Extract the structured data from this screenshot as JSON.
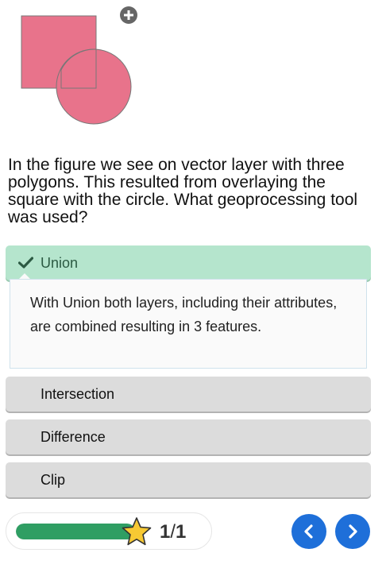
{
  "figure": {
    "square_color": "#e8738b",
    "circle_color": "#e8738b",
    "overlap_color": "#e8738b",
    "expand_icon": "plus-circle-icon"
  },
  "question": {
    "text": "In the figure we see on vector layer with three polygons. This resulted from overlaying the square with the circle. What geoprocessing tool was used?"
  },
  "options": [
    {
      "label": "Union",
      "state": "correct"
    },
    {
      "label": "Intersection",
      "state": "default"
    },
    {
      "label": "Difference",
      "state": "default"
    },
    {
      "label": "Clip",
      "state": "default"
    }
  ],
  "feedback": {
    "text": "With Union both layers, including their attributes, are combined resulting in 3 features."
  },
  "progress": {
    "fraction": 1.0,
    "current": "1",
    "separator": "/",
    "total": "1",
    "bar_color": "#2f9e63",
    "star_color": "#f7c933"
  },
  "navigation": {
    "prev_icon": "chevron-left-icon",
    "next_icon": "chevron-right-icon",
    "button_color": "#1e6fd9"
  }
}
